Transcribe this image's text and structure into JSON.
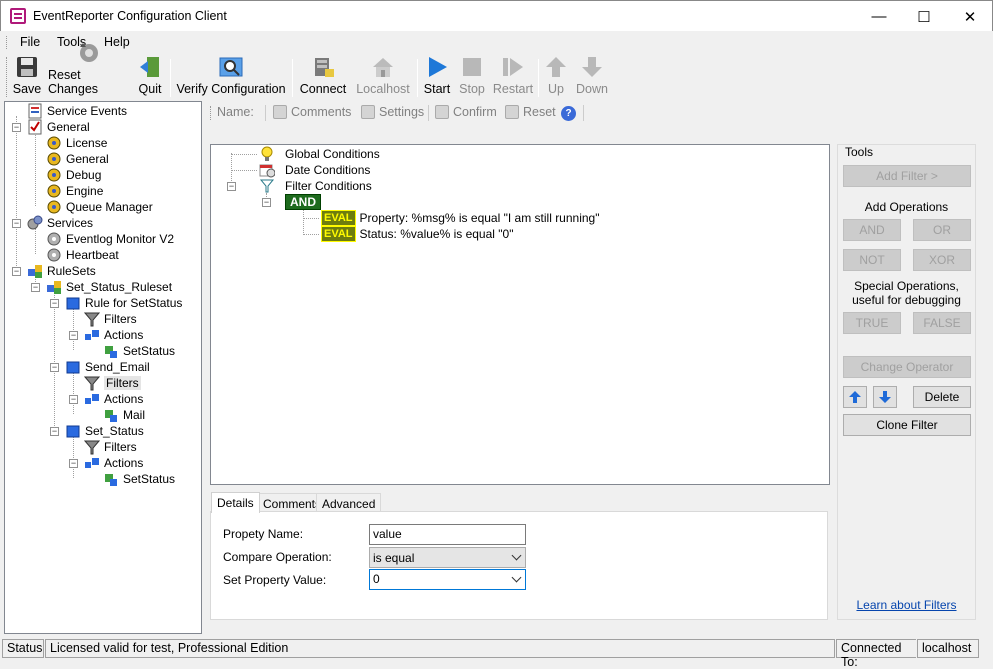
{
  "window": {
    "title": "EventReporter Configuration Client",
    "minimize": "—",
    "maximize": "☐",
    "close": "✕"
  },
  "menu": {
    "file": "File",
    "tools": "Tools",
    "help": "Help"
  },
  "toolbar": {
    "save": "Save",
    "reset_changes": "Reset Changes",
    "quit": "Quit",
    "verify": "Verify Configuration",
    "connect": "Connect",
    "localhost": "Localhost",
    "start": "Start",
    "stop": "Stop",
    "restart": "Restart",
    "up": "Up",
    "down": "Down"
  },
  "tree": {
    "service_events": "Service Events",
    "general": "General",
    "license": "License",
    "general_child": "General",
    "debug": "Debug",
    "engine": "Engine",
    "queue_manager": "Queue Manager",
    "services": "Services",
    "eventlog_monitor": "Eventlog Monitor V2",
    "heartbeat": "Heartbeat",
    "rulesets": "RuleSets",
    "ruleset": "Set_Status_Ruleset",
    "rule1": "Rule for SetStatus",
    "rule1_filters": "Filters",
    "rule1_actions": "Actions",
    "rule1_action": "SetStatus",
    "rule2": "Send_Email",
    "rule2_filters": "Filters",
    "rule2_actions": "Actions",
    "rule2_action": "Mail",
    "rule3": "Set_Status",
    "rule3_filters": "Filters",
    "rule3_actions": "Actions",
    "rule3_action": "SetStatus"
  },
  "subtoolbar": {
    "name": "Name:",
    "comments": "Comments",
    "settings": "Settings",
    "confirm": "Confirm",
    "reset": "Reset",
    "help": "?"
  },
  "filters": {
    "global": "Global Conditions",
    "date": "Date Conditions",
    "filter": "Filter Conditions",
    "and": "AND",
    "eval": "EVAL",
    "cond1": "Property: %msg% is equal \"I am still running\"",
    "cond2": "Status: %value% is equal \"0\""
  },
  "tabs": {
    "details": "Details",
    "comments": "Comments",
    "advanced": "Advanced"
  },
  "details": {
    "property_name_label": "Propety Name:",
    "property_name_value": "value",
    "compare_label": "Compare Operation:",
    "compare_value": "is equal",
    "set_value_label": "Set Property Value:",
    "set_value_value": "0"
  },
  "tools": {
    "title": "Tools",
    "add_filter": "Add Filter >",
    "add_operations": "Add Operations",
    "and": "AND",
    "or": "OR",
    "not": "NOT",
    "xor": "XOR",
    "special_line1": "Special Operations,",
    "special_line2": "useful for debugging",
    "true": "TRUE",
    "false": "FALSE",
    "change_operator": "Change Operator",
    "delete": "Delete",
    "clone_filter": "Clone Filter",
    "learn": "Learn about Filters"
  },
  "status": {
    "status": "Status",
    "license": "Licensed valid for test, Professional Edition",
    "connected_to": "Connected To:",
    "host": "localhost"
  },
  "colors": {
    "accent": "#0066cc",
    "and_bg": "#1e6b1e",
    "eval_bg": "#6e7d0e",
    "link": "#0645ad"
  }
}
